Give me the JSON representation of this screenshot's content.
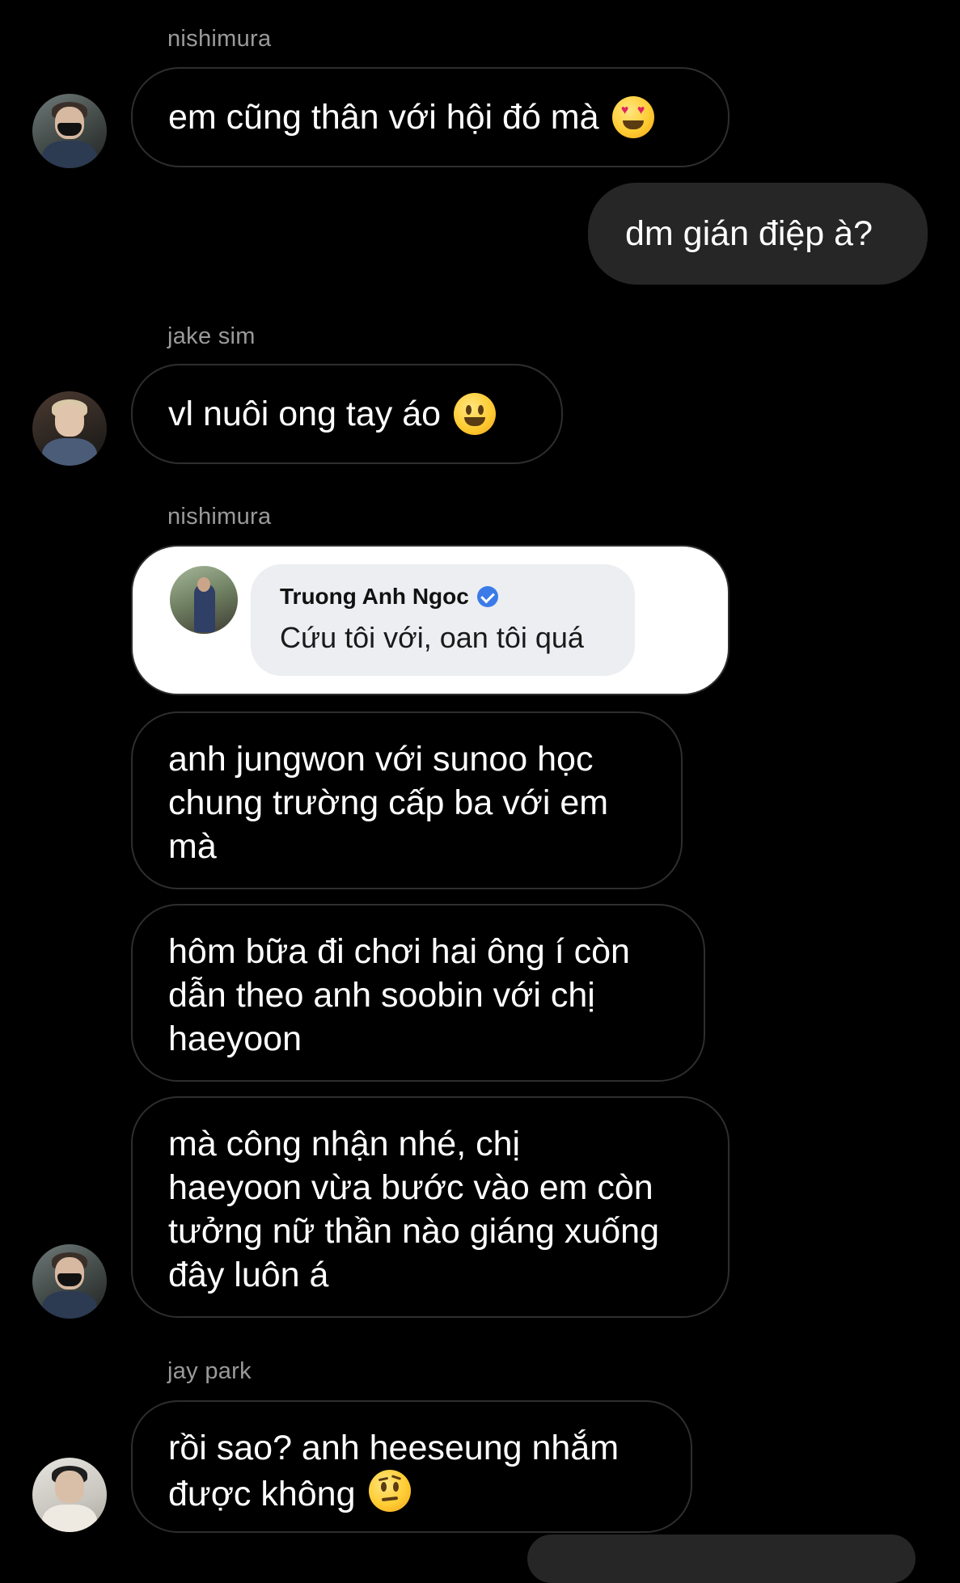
{
  "messages": {
    "sender1": "nishimura",
    "msg1": "em cũng thân với hội đó mà",
    "msg1_emoji": "heart-eyes-emoji",
    "outgoing1": "dm gián điệp à?",
    "sender2": "jake sim",
    "msg2": "vl nuôi ong tay áo",
    "msg2_emoji": "smiling-face-emoji",
    "sender3": "nishimura",
    "shared_comment": {
      "name": "Truong Anh Ngoc",
      "text": "Cứu tôi với, oan tôi quá"
    },
    "msg4_lines": [
      "anh jungwon với sunoo học",
      "chung trường cấp ba với em",
      "mà"
    ],
    "msg5_lines": [
      "hôm bữa đi chơi hai ông í còn",
      "dẫn theo anh soobin với chị",
      "haeyoon"
    ],
    "msg6_lines": [
      "mà công nhận nhé, chị",
      "haeyoon vừa bước vào em còn",
      "tưởng nữ thần nào giáng xuống",
      "đây luôn á"
    ],
    "sender4": "jay park",
    "msg7_lines": [
      "rồi sao? anh heeseung nhắm",
      "được không"
    ],
    "msg7_emoji": "raised-eyebrow-emoji"
  },
  "colors": {
    "background": "#000000",
    "incoming_border": "#2e2e2e",
    "outgoing_bg": "#262626",
    "sender_text": "#9a9a9a",
    "verified_badge": "#3b7be8"
  }
}
